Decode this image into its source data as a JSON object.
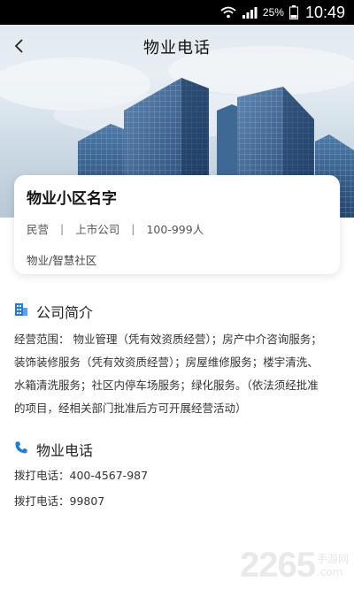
{
  "status_bar": {
    "battery_percent": "25%",
    "time": "10:49"
  },
  "nav": {
    "title": "物业电话"
  },
  "company": {
    "name": "物业小区名字",
    "tags": [
      "民营",
      "上市公司",
      "100-999人"
    ],
    "industry": "物业/智慧社区"
  },
  "intro": {
    "title": "公司简介",
    "lines": [
      "经营范围： 物业管理（凭有效资质经营）；房产中介咨询服务；",
      "装饰装修服务（凭有效资质经营）；房屋维修服务；楼宇清洗、",
      "水箱清洗服务；社区内停车场服务；绿化服务。（依法须经批准",
      "的项目，经相关部门批准后方可开展经营活动）"
    ]
  },
  "phone": {
    "title": "物业电话",
    "entries": [
      "拨打电话：400-4567-987",
      "拨打电话：99807"
    ]
  },
  "watermark": {
    "number": "2265",
    "site_cn": "手游网",
    "site_url": ".com"
  },
  "colors": {
    "accent_blue": "#1e7bd9",
    "text_dark": "#222222"
  },
  "icons": {
    "back": "chevron-left-icon",
    "intro": "building-icon",
    "phone": "phone-icon"
  }
}
